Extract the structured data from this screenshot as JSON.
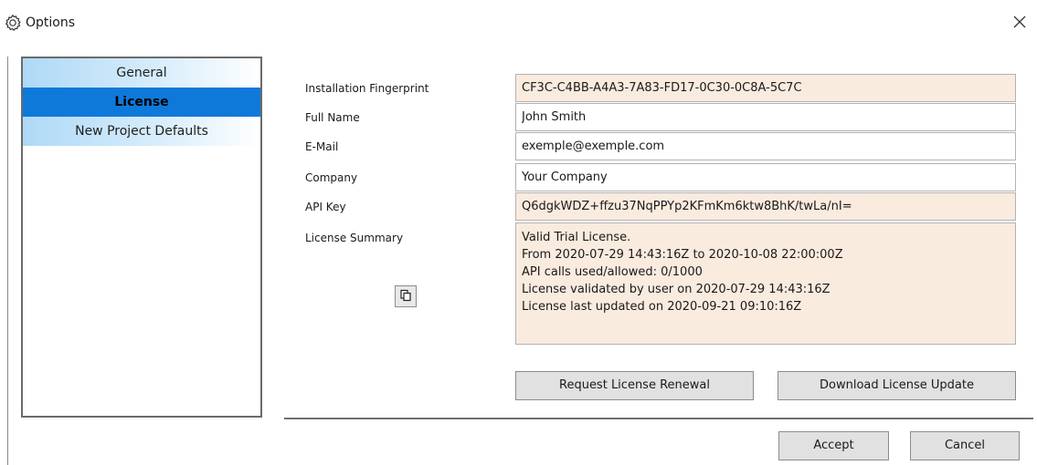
{
  "window": {
    "title": "Options",
    "icon": "gear-icon",
    "close_icon": "close-icon"
  },
  "sidebar": {
    "items": [
      {
        "label": "General",
        "selected": false
      },
      {
        "label": "License",
        "selected": true
      },
      {
        "label": "New Project Defaults",
        "selected": false
      }
    ]
  },
  "license": {
    "fingerprint_label": "Installation Fingerprint",
    "fingerprint_value": "CF3C-C4BB-A4A3-7A83-FD17-0C30-0C8A-5C7C",
    "fullname_label": "Full Name",
    "fullname_value": "John Smith",
    "email_label": "E-Mail",
    "email_value": "exemple@exemple.com",
    "company_label": "Company",
    "company_value": "Your Company",
    "apikey_label": "API Key",
    "apikey_value": "Q6dgkWDZ+ffzu37NqPPYp2KFmKm6ktw8BhK/twLa/nI=",
    "summary_label": "License Summary",
    "summary_lines": [
      "Valid Trial License.",
      "From 2020-07-29 14:43:16Z to 2020-10-08 22:00:00Z",
      "API calls used/allowed: 0/1000",
      "License validated by user on 2020-07-29 14:43:16Z",
      "License last updated on 2020-09-21 09:10:16Z"
    ],
    "copy_icon": "copy-icon",
    "request_renewal_label": "Request License Renewal",
    "download_update_label": "Download License Update"
  },
  "footer": {
    "accept_label": "Accept",
    "cancel_label": "Cancel"
  },
  "colors": {
    "selected_nav": "#0f79da",
    "readonly_field": "#faebdf"
  }
}
